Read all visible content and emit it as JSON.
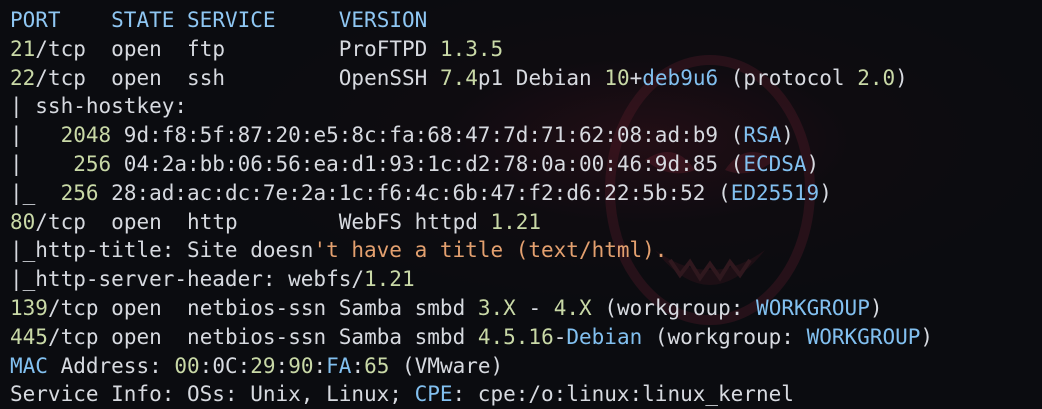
{
  "header": {
    "port": "PORT",
    "state": "STATE",
    "service": "SERVICE",
    "version": "VERSION"
  },
  "rows": {
    "r21": {
      "port_num": "21",
      "proto": "/tcp",
      "state": "open",
      "service": "ftp",
      "prod": "ProFTPD ",
      "ver": "1.3.5"
    },
    "r22": {
      "port_num": "22",
      "proto": "/tcp",
      "state": "open",
      "service": "ssh",
      "prod": "OpenSSH ",
      "v1": "7.4",
      "v2": "p1 Debian ",
      "v3": "10",
      "v4": "+",
      "v5": "deb9u6",
      "v6": " (protocol ",
      "v7": "2.0",
      "v8": ")"
    },
    "hostkey": "| ssh-hostkey:",
    "k1": {
      "lead": "|   ",
      "bits": "2048",
      "fp": " 9d:f8:5f:87:20:e5:8c:fa:68:47:7d:71:62:08:ad:b9",
      "typeopen": " (",
      "type": "RSA",
      "typeclose": ")"
    },
    "k2": {
      "lead": "|    ",
      "bits": "256",
      "fp": " 04:2a:bb:06:56:ea:d1:93:1c:d2:78:0a:00:46:9d:85",
      "typeopen": " (",
      "type": "ECDSA",
      "typeclose": ")"
    },
    "k3": {
      "lead": "|_",
      "gap": "  ",
      "bits": "256",
      "fp": " 28:ad:ac:dc:7e:2a:1c:f6:4c:6b:47:f2:d6:22:5b:52",
      "typeopen": " (",
      "type": "ED25519",
      "typeclose": ")"
    },
    "r80": {
      "port_num": "80",
      "proto": "/tcp",
      "state": "open",
      "service": "http",
      "prod": "WebFS httpd ",
      "ver": "1.21"
    },
    "title": {
      "a": "|_http-title: Site doesn",
      "b": "'t have a title (text/html)."
    },
    "server": {
      "a": "|_http-server-header: webfs/",
      "b": "1.21"
    },
    "r139": {
      "port_num": "139",
      "proto": "/tcp",
      "state": "open",
      "service": "netbios-ssn",
      "prod": "Samba smbd ",
      "v1": "3.X",
      "v2": " - ",
      "v3": "4.X",
      "v4": " (workgroup: ",
      "v5": "WORKGROUP",
      "v6": ")"
    },
    "r445": {
      "port_num": "445",
      "proto": "/tcp",
      "state": "open",
      "service": "netbios-ssn",
      "prod": "Samba smbd ",
      "v1": "4.5.16",
      "v2": "-",
      "v3": "Debian",
      "v4": " (workgroup: ",
      "v5": "WORKGROUP",
      "v6": ")"
    },
    "mac": {
      "label": "MAC",
      "a": " Address: ",
      "b": "00",
      "c": ":0C:",
      "d": "29",
      "e": ":",
      "f": "90",
      "g": ":",
      "h": "FA",
      "i": ":",
      "j": "65",
      "k": " (VMware)"
    },
    "svc": {
      "a": "Service Info: OSs: Unix, Linux; ",
      "b": "CPE",
      "c": ": cpe:/o:linux:linux_kernel"
    }
  },
  "icons": {
    "watermark": "masked-face-watermark-icon"
  }
}
